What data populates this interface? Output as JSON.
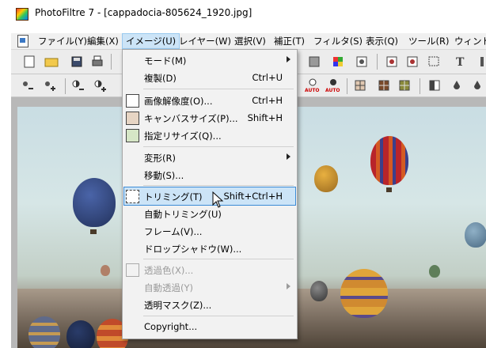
{
  "window": {
    "title": "PhotoFiltre 7 - [cappadocia-805624_1920.jpg]",
    "icon": "photofiltre-app-icon"
  },
  "menubar": {
    "items": [
      {
        "label": "ファイル(Y)"
      },
      {
        "label": "編集(X)"
      },
      {
        "label": "イメージ(U)",
        "active": true
      },
      {
        "label": "レイヤー(W)"
      },
      {
        "label": "選択(V)"
      },
      {
        "label": "補正(T)"
      },
      {
        "label": "フィルタ(S)"
      },
      {
        "label": "表示(Q)"
      },
      {
        "label": "ツール(R)"
      },
      {
        "label": "ウィンドウ"
      }
    ]
  },
  "toolbar_icons": {
    "row1": [
      "new-file-icon",
      "open-folder-icon",
      "save-icon",
      "print-icon",
      "gradient-icon",
      "color-grid-icon",
      "resize-icon",
      "canvas-icon",
      "select-icon",
      "text-icon"
    ],
    "row2": [
      "brightness-minus-icon",
      "brightness-plus-icon",
      "contrast-minus-icon",
      "contrast-plus-icon",
      "auto-level-icon",
      "grid-icon",
      "drop-icon",
      "sharpen-icon"
    ],
    "auto_label": "AUTO"
  },
  "image_menu": {
    "items": [
      {
        "label": "モード(M)",
        "submenu": true
      },
      {
        "label": "複製(D)",
        "shortcut": "Ctrl+U"
      },
      {
        "separator": true
      },
      {
        "label": "画像解像度(O)...",
        "shortcut": "Ctrl+H",
        "icon": "image-resolution-icon"
      },
      {
        "label": "キャンバスサイズ(P)...",
        "shortcut": "Shift+H",
        "icon": "canvas-size-icon"
      },
      {
        "label": "指定リサイズ(Q)...",
        "icon": "fit-resize-icon"
      },
      {
        "separator": true
      },
      {
        "label": "変形(R)",
        "submenu": true
      },
      {
        "label": "移動(S)..."
      },
      {
        "separator": true
      },
      {
        "label": "トリミング(T)",
        "shortcut": "Shift+Ctrl+H",
        "icon": "crop-icon",
        "highlight": true
      },
      {
        "label": "自動トリミング(U)"
      },
      {
        "label": "フレーム(V)..."
      },
      {
        "label": "ドロップシャドウ(W)..."
      },
      {
        "separator": true
      },
      {
        "label": "透過色(X)...",
        "disabled": true,
        "icon": "transparency-color-icon"
      },
      {
        "label": "自動透過(Y)",
        "disabled": true,
        "submenu": true
      },
      {
        "label": "透明マスク(Z)..."
      },
      {
        "separator": true
      },
      {
        "label": "Copyright..."
      }
    ]
  },
  "colors": {
    "menu_highlight": "#cce4f7",
    "menu_highlight_border": "#3b8bd6",
    "disabled_text": "#9b9b9b"
  }
}
